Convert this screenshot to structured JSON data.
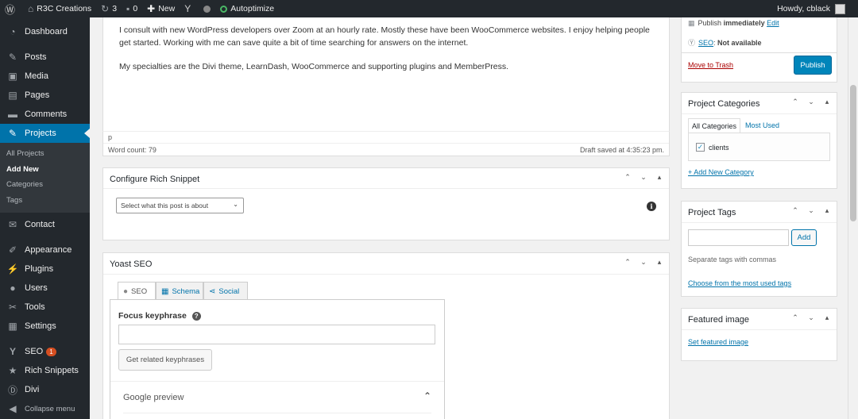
{
  "adminbar": {
    "site_name": "R3C Creations",
    "updates_count": "3",
    "comments_count": "0",
    "new_label": "New",
    "autoptimize_label": "Autoptimize",
    "howdy": "Howdy, cblack"
  },
  "sidebar": {
    "items": [
      {
        "label": "Dashboard",
        "icon": "dashboard-icon"
      },
      {
        "label": "Posts",
        "icon": "pin-icon"
      },
      {
        "label": "Media",
        "icon": "media-icon"
      },
      {
        "label": "Pages",
        "icon": "page-icon"
      },
      {
        "label": "Comments",
        "icon": "comment-icon"
      },
      {
        "label": "Projects",
        "icon": "pin-icon"
      },
      {
        "label": "Contact",
        "icon": "mail-icon"
      },
      {
        "label": "Appearance",
        "icon": "brush-icon"
      },
      {
        "label": "Plugins",
        "icon": "plugin-icon"
      },
      {
        "label": "Users",
        "icon": "user-icon"
      },
      {
        "label": "Tools",
        "icon": "wrench-icon"
      },
      {
        "label": "Settings",
        "icon": "settings-icon"
      },
      {
        "label": "SEO",
        "icon": "yoast-icon",
        "badge": "1"
      },
      {
        "label": "Rich Snippets",
        "icon": "star-icon"
      },
      {
        "label": "Divi",
        "icon": "divi-icon"
      },
      {
        "label": "Collapse menu",
        "icon": "collapse-icon"
      }
    ],
    "submenu": [
      "All Projects",
      "Add New",
      "Categories",
      "Tags"
    ]
  },
  "editor": {
    "paragraph1": "I consult with new WordPress developers over Zoom at an hourly rate.  Mostly these have been WooCommerce websites.  I enjoy helping people get started. Working with me can save quite a bit of time searching for answers on the internet.",
    "paragraph2": "My specialties are the Divi theme, LearnDash, WooCommerce and supporting plugins and MemberPress.",
    "path": "p",
    "word_count": "Word count: 79",
    "draft_saved": "Draft saved at 4:35:23 pm."
  },
  "rich_snippet": {
    "title": "Configure Rich Snippet",
    "select_value": "Select what this post is about"
  },
  "yoast": {
    "title": "Yoast SEO",
    "tabs": [
      "SEO",
      "Schema",
      "Social"
    ],
    "focus_label": "Focus keyphrase",
    "related_btn": "Get related keyphrases",
    "google_preview": "Google preview"
  },
  "publish": {
    "publish_prefix": "Publish",
    "publish_when": "immediately",
    "edit_link": "Edit",
    "seo_link": "SEO",
    "seo_status": "Not available",
    "trash_link": "Move to Trash",
    "publish_btn": "Publish"
  },
  "categories": {
    "title": "Project Categories",
    "tab_all": "All Categories",
    "tab_used": "Most Used",
    "item": "clients",
    "add_link": "+ Add New Category"
  },
  "tags": {
    "title": "Project Tags",
    "add_btn": "Add",
    "hint": "Separate tags with commas",
    "choose_link": "Choose from the most used tags"
  },
  "featured": {
    "title": "Featured image",
    "set_link": "Set featured image"
  },
  "colors": {
    "accent": "#0073aa",
    "sidebar": "#23282d",
    "publish": "#0085ba"
  }
}
